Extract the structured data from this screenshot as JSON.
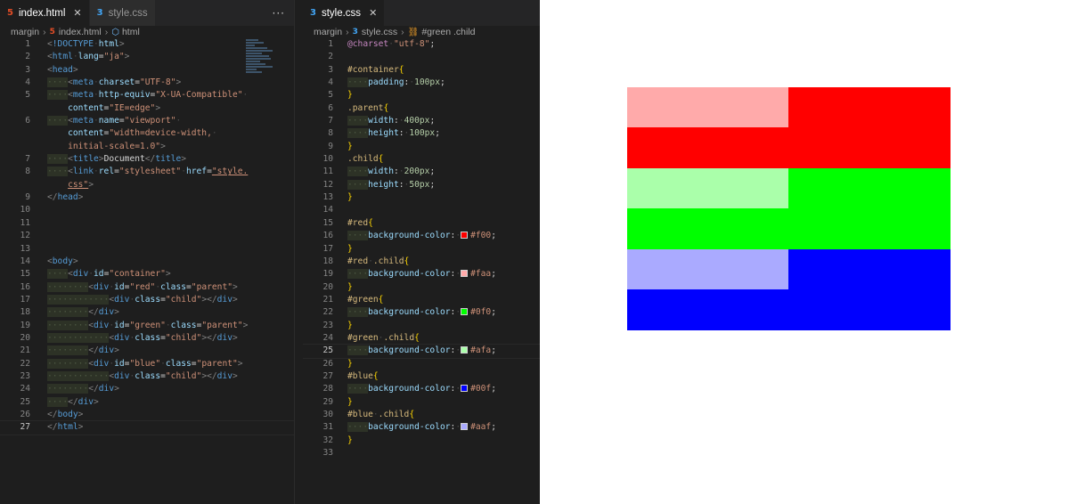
{
  "left_pane": {
    "tabs": [
      {
        "icon": "html5-icon",
        "label": "index.html",
        "active": true
      },
      {
        "icon": "css3-icon",
        "label": "style.css",
        "active": false
      }
    ],
    "more": "···",
    "breadcrumb": [
      "margin",
      "index.html",
      "html"
    ],
    "current_line": 27
  },
  "right_pane": {
    "tabs": [
      {
        "icon": "css3-icon",
        "label": "style.css",
        "active": true
      }
    ],
    "breadcrumb": [
      "margin",
      "style.css",
      "#green .child"
    ],
    "current_line": 25
  },
  "html_code": [
    "<!DOCTYPE html>",
    "<html lang=\"ja\">",
    "<head>",
    "    <meta charset=\"UTF-8\">",
    "    <meta http-equiv=\"X-UA-Compatible\"",
    "    content=\"IE=edge\">",
    "    <meta name=\"viewport\"",
    "    content=\"width=device-width,",
    "    initial-scale=1.0\">",
    "    <title>Document</title>",
    "    <link rel=\"stylesheet\" href=\"style.",
    "    css\">",
    "</head>",
    "",
    "",
    "",
    "",
    "<body>",
    "    <div id=\"container\">",
    "        <div id=\"red\" class=\"parent\">",
    "            <div class=\"child\"></div>",
    "        </div>",
    "        <div id=\"green\" class=\"parent\">",
    "            <div class=\"child\"></div>",
    "        </div>",
    "        <div id=\"blue\" class=\"parent\">",
    "            <div class=\"child\"></div>",
    "        </div>",
    "    </div>",
    "</body>",
    "</html>"
  ],
  "css_code": [
    "@charset \"utf-8\";",
    "",
    "#container{",
    "    padding: 100px;",
    "}",
    ".parent{",
    "    width: 400px;",
    "    height: 100px;",
    "}",
    ".child{",
    "    width: 200px;",
    "    height: 50px;",
    "}",
    "",
    "#red{",
    "    background-color: #f00;",
    "}",
    "#red .child{",
    "    background-color: #faa;",
    "}",
    "#green{",
    "    background-color: #0f0;",
    "}",
    "#green .child{",
    "    background-color: #afa;",
    "}",
    "#blue{",
    "    background-color: #00f;",
    "}",
    "#blue .child{",
    "    background-color: #aaf;",
    "}",
    ""
  ],
  "preview": {
    "blocks": [
      {
        "id": "red",
        "parent_color": "#ff0000",
        "child_color": "#ffaaaa"
      },
      {
        "id": "green",
        "parent_color": "#00ff00",
        "child_color": "#aaffaa"
      },
      {
        "id": "blue",
        "parent_color": "#0000ff",
        "child_color": "#aaaaff"
      }
    ]
  },
  "colors": {
    "editor_bg": "#1e1e1e",
    "tab_inactive_bg": "#2d2d2d",
    "html_icon": "#e44d26",
    "css_icon": "#42a5f5"
  }
}
